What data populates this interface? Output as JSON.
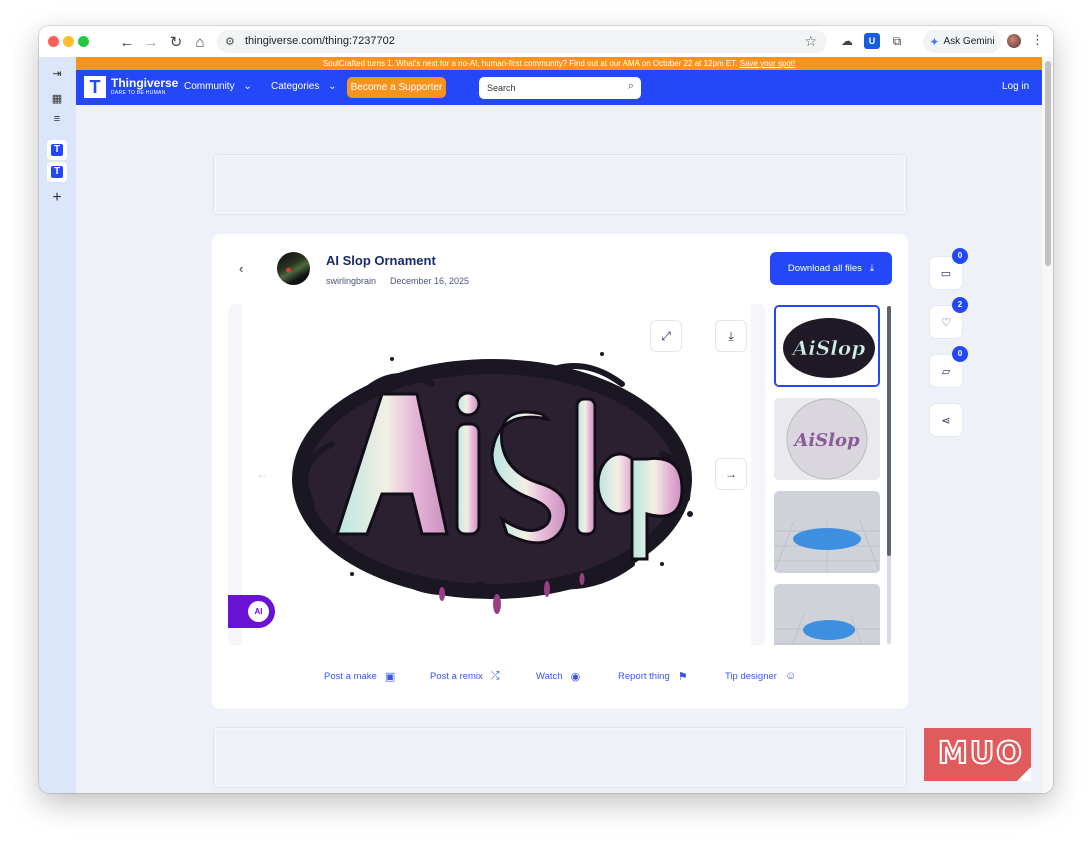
{
  "browser": {
    "url": "thingiverse.com/thing:7237702",
    "gemini_label": "Ask Gemini"
  },
  "banner": {
    "text": "SoulCrafted turns 1. What's next for a no-AI, human-first community? Find out at our AMA on October 22 at 12pm ET.",
    "link": "Save your spot!"
  },
  "nav": {
    "brand": "Thingiverse",
    "tagline": "DARE TO BE HUMAN",
    "community": "Community",
    "categories": "Categories",
    "supporter": "Become a Supporter",
    "search_placeholder": "Search",
    "login": "Log in"
  },
  "thing": {
    "title": "AI Slop Ornament",
    "author": "swirlingbrain",
    "date": "December 16, 2025",
    "download_label": "Download all files",
    "ai_badge": "AI"
  },
  "actions": {
    "post_make": "Post a make",
    "post_remix": "Post a remix",
    "watch": "Watch",
    "report": "Report thing",
    "tip": "Tip designer"
  },
  "counts": {
    "comments": "0",
    "likes": "2",
    "collections": "0"
  },
  "watermark": "MUO"
}
